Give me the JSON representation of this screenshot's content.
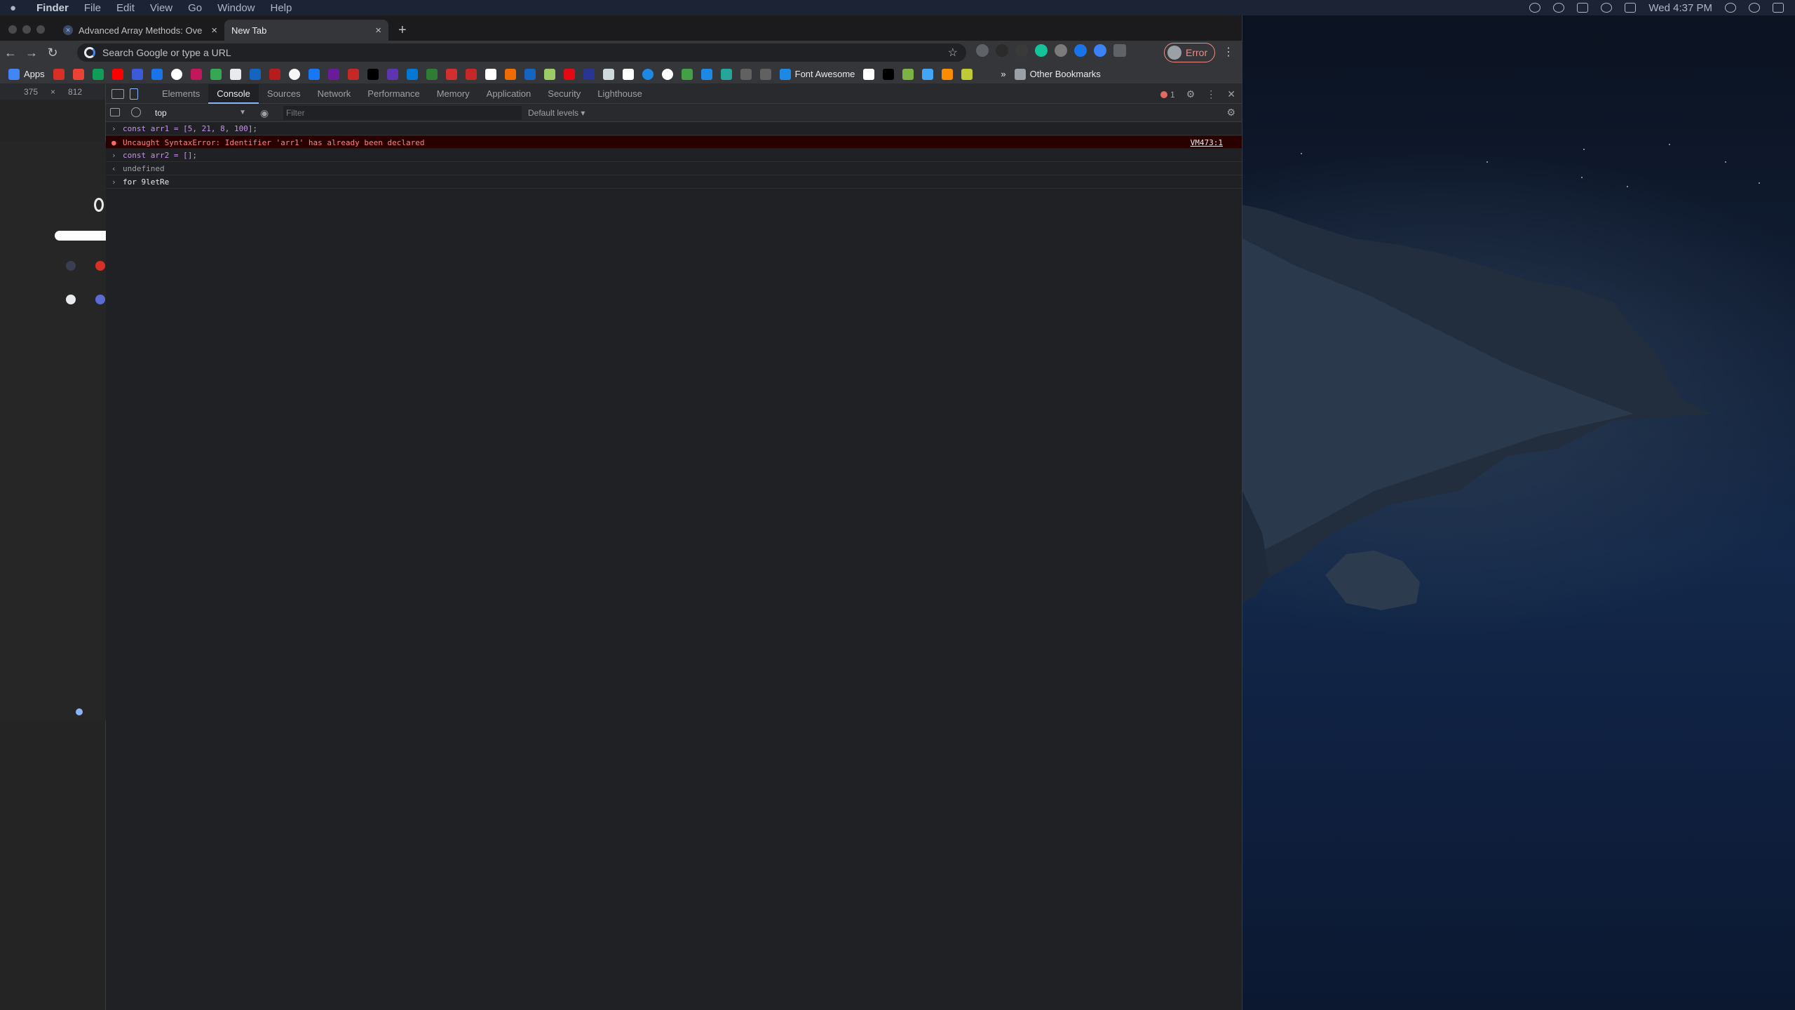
{
  "menubar": {
    "items": [
      "Finder",
      "File",
      "Edit",
      "View",
      "Go",
      "Window",
      "Help"
    ],
    "clock": "Wed 4:37 PM"
  },
  "browser": {
    "tabs": [
      {
        "title": "Advanced Array Methods: Ove",
        "active": false
      },
      {
        "title": "New Tab",
        "active": true
      }
    ],
    "omnibox_placeholder": "Search Google or type a URL",
    "profile_label": "Error",
    "bookmarks": {
      "apps": "Apps",
      "font_awesome": "Font Awesome",
      "other": "Other Bookmarks",
      "overflow": "»"
    }
  },
  "device_toolbar": {
    "width": "375",
    "times": "×",
    "height": "812"
  },
  "devtools": {
    "tabs": [
      "Elements",
      "Console",
      "Sources",
      "Network",
      "Performance",
      "Memory",
      "Application",
      "Security",
      "Lighthouse"
    ],
    "active_tab": "Console",
    "error_count": "1",
    "context": "top",
    "filter_placeholder": "Filter",
    "levels": "Default levels ▾"
  },
  "console": {
    "lines": [
      {
        "type": "input",
        "text": "const arr1 = [5, 21, 8, 100];"
      },
      {
        "type": "error",
        "text": "Uncaught SyntaxError: Identifier 'arr1' has already been declared",
        "source": "VM473:1"
      },
      {
        "type": "input",
        "text": "const arr2 = [];"
      },
      {
        "type": "output",
        "text": "undefined"
      },
      {
        "type": "input",
        "text": "for 9letRe"
      }
    ]
  },
  "colors": {
    "error_bg": "#290000",
    "error_text": "#ff8080",
    "accent": "#8ab4f8"
  }
}
